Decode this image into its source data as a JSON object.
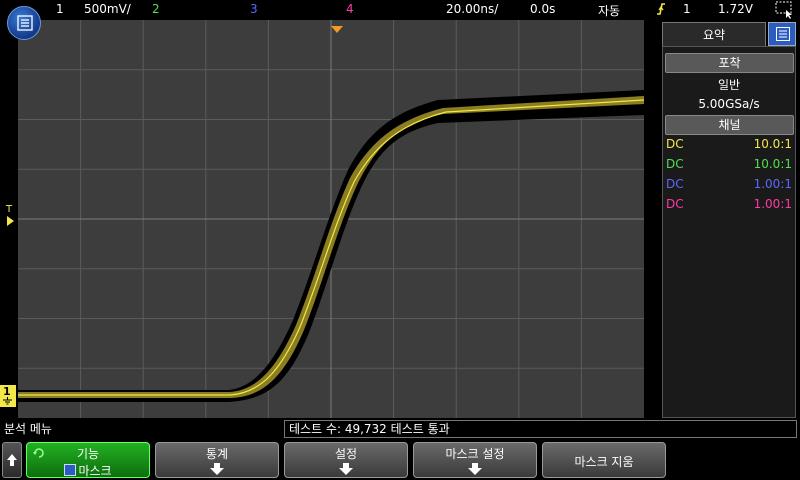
{
  "status_bar": {
    "ch1_num": "1",
    "ch1_scale": "500mV/",
    "ch2_num": "2",
    "ch3_num": "3",
    "ch4_num": "4",
    "timebase": "20.00ns/",
    "delay": "0.0s",
    "trigger_mode": "자동",
    "trigger_source": "1",
    "trigger_level": "1.72V"
  },
  "colors": {
    "ch1": "#f2e84a",
    "ch2": "#4ee04e",
    "ch3": "#5a6aff",
    "ch4": "#ff3aa5",
    "trigger_marker": "#f29a2a"
  },
  "icons": {
    "menu": "menu-list-icon",
    "trigger_edge": "rising-edge-icon",
    "screen": "screen-select-icon",
    "panel_tab": "panel-list-icon",
    "back": "back-arrow-icon",
    "mask": "checkbox-icon"
  },
  "right_panel": {
    "tab_label": "요약",
    "acquisition_header": "포착",
    "acq_mode": "일반",
    "sample_rate": "5.00GSa/s",
    "channel_header": "채널",
    "channels": [
      {
        "coupling": "DC",
        "probe": "10.0:1"
      },
      {
        "coupling": "DC",
        "probe": "10.0:1"
      },
      {
        "coupling": "DC",
        "probe": "1.00:1"
      },
      {
        "coupling": "DC",
        "probe": "1.00:1"
      }
    ]
  },
  "markers": {
    "trigger_level_label": "T",
    "ch1_ground_label": "1"
  },
  "bottom": {
    "menu_title": "분석 메뉴",
    "status_message": "테스트 수: 49,732  테스트 통과",
    "softkeys": [
      {
        "label": "기능",
        "sub": "마스크"
      },
      {
        "label": "통계"
      },
      {
        "label": "설정"
      },
      {
        "label": "마스크 설정"
      },
      {
        "label": "마스크 지움"
      }
    ]
  }
}
